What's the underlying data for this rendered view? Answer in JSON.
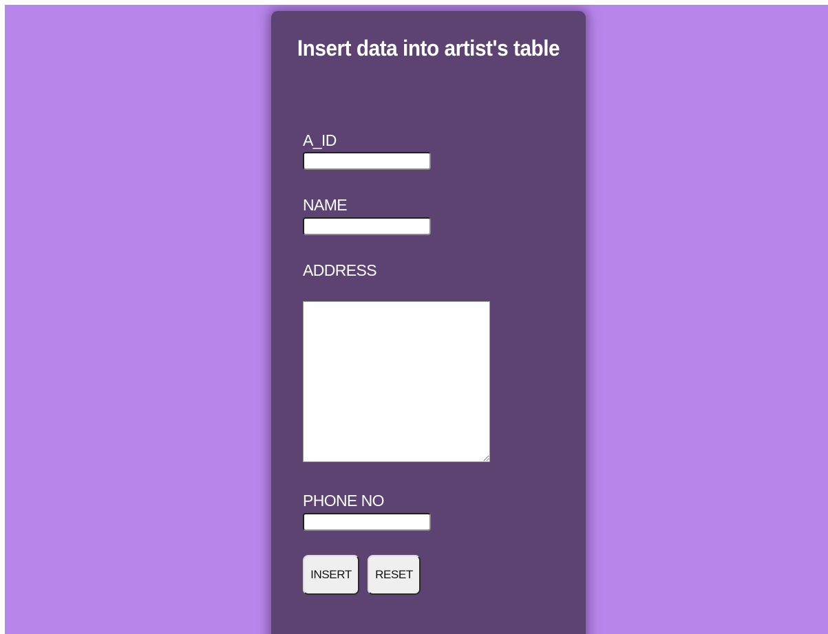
{
  "page": {
    "title": "Insert data into artist's table"
  },
  "form": {
    "a_id": {
      "label": "A_ID",
      "value": "",
      "placeholder": ""
    },
    "name": {
      "label": "NAME",
      "value": "",
      "placeholder": ""
    },
    "address": {
      "label": "ADDRESS",
      "value": "",
      "placeholder": ""
    },
    "phone": {
      "label": "PHONE NO",
      "value": "",
      "placeholder": ""
    }
  },
  "buttons": {
    "insert_label": "INSERT",
    "reset_label": "RESET"
  },
  "colors": {
    "background": "#b886eb",
    "card": "#5c4372",
    "text": "#ffffff",
    "button": "#efefef"
  }
}
